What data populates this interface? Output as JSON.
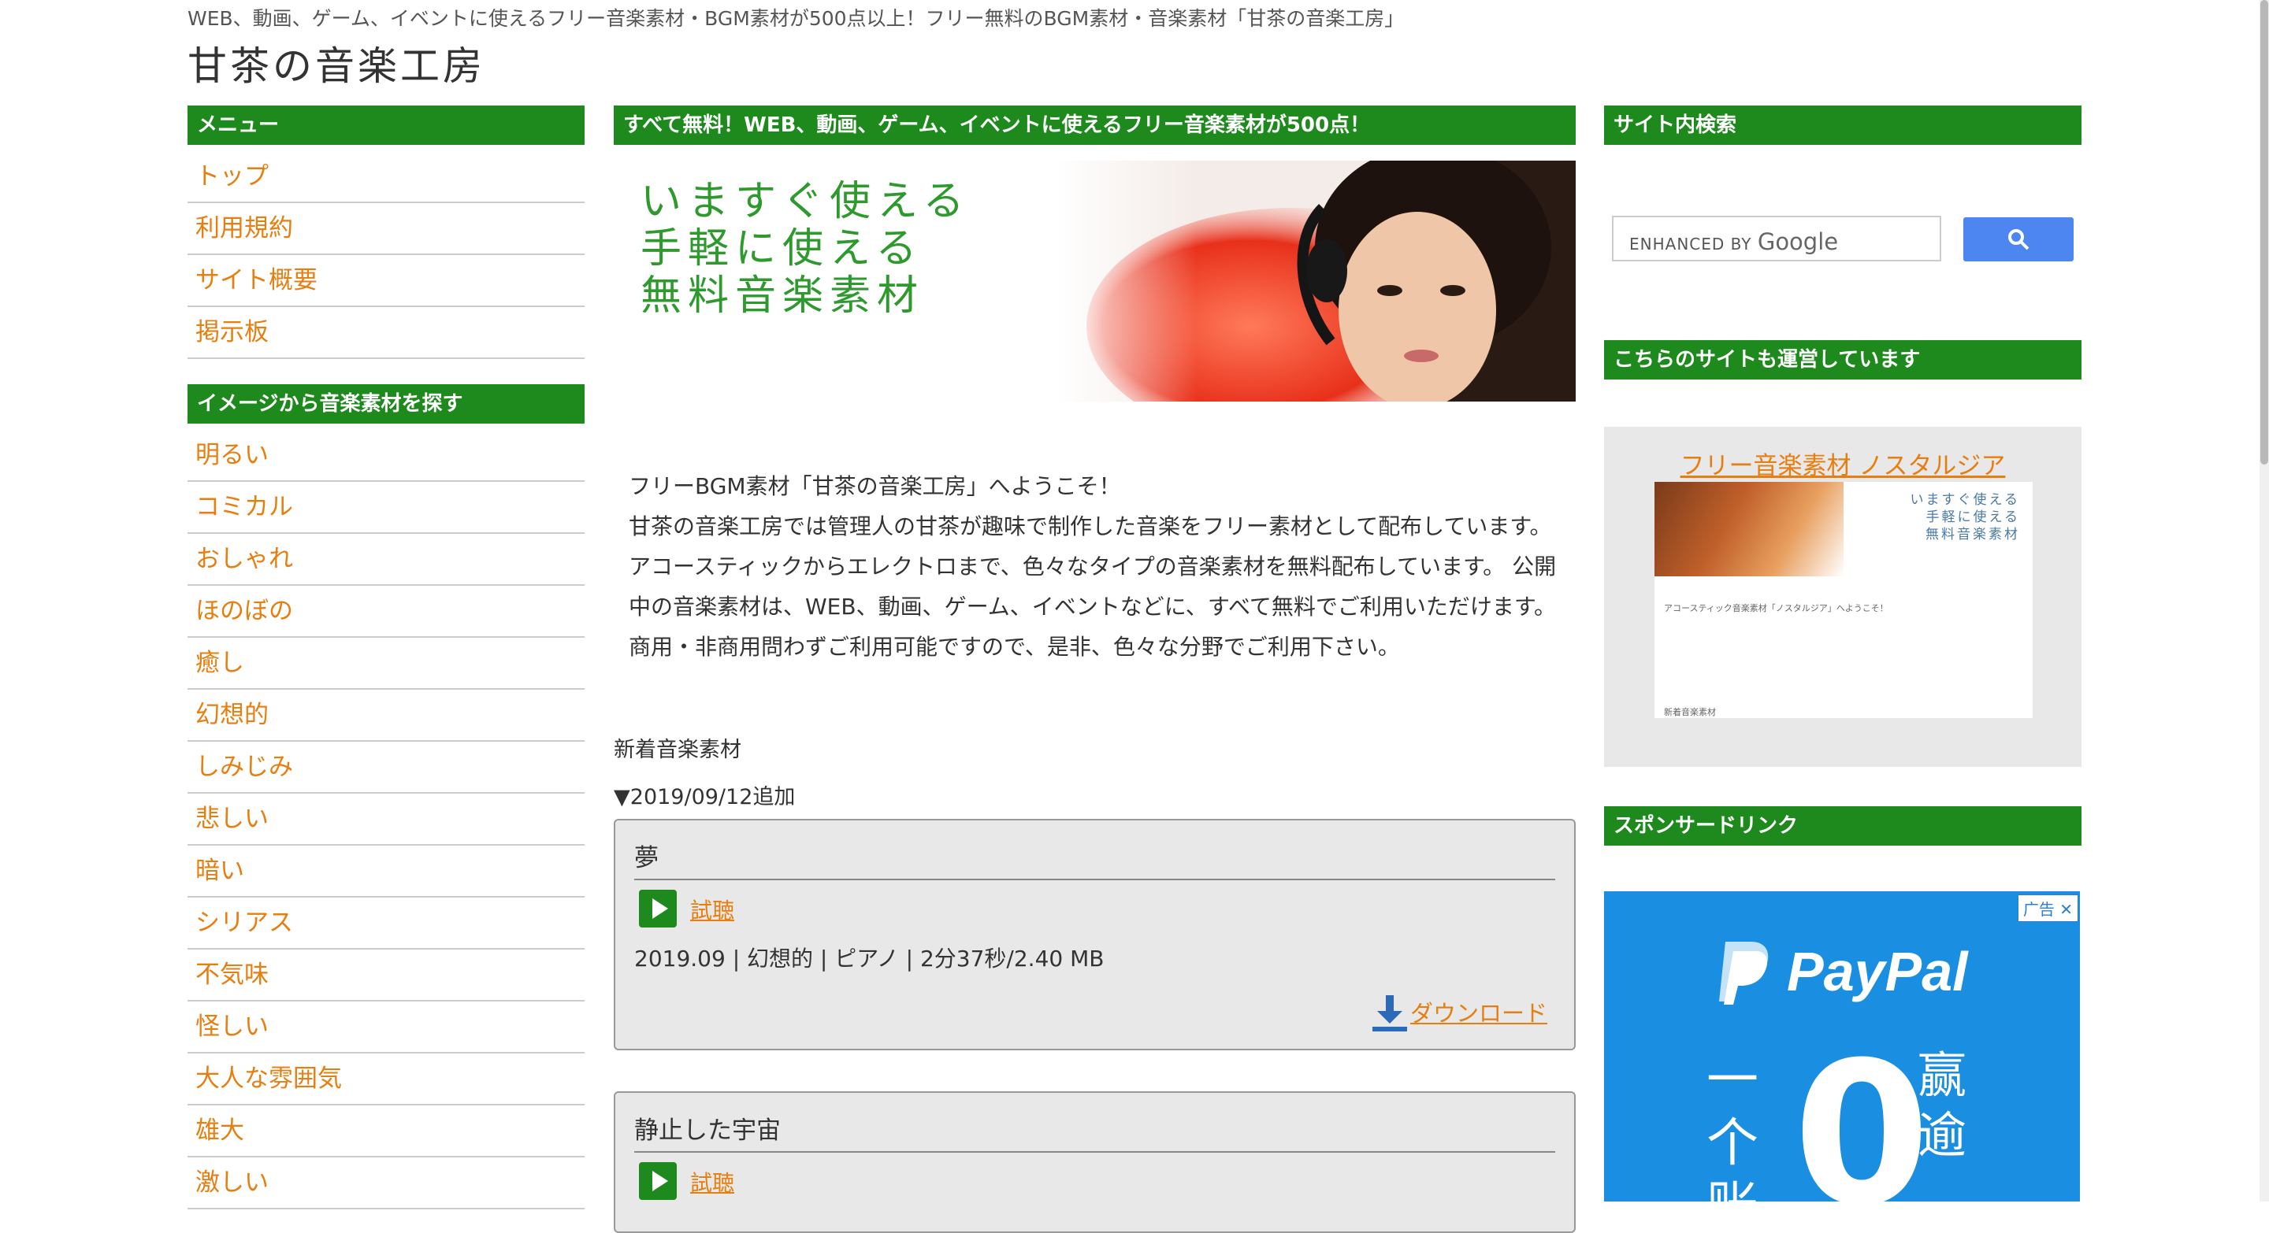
{
  "header": {
    "tagline": "WEB、動画、ゲーム、イベントに使えるフリー音楽素材・BGM素材が500点以上！フリー無料のBGM素材・音楽素材「甘茶の音楽工房」",
    "site_title": "甘茶の音楽工房"
  },
  "sidebar_left": {
    "menu_heading": "メニュー",
    "menu_items": [
      "トップ",
      "利用規約",
      "サイト概要",
      "掲示板"
    ],
    "image_heading": "イメージから音楽素材を探す",
    "image_items": [
      "明るい",
      "コミカル",
      "おしゃれ",
      "ほのぼの",
      "癒し",
      "幻想的",
      "しみじみ",
      "悲しい",
      "暗い",
      "シリアス",
      "不気味",
      "怪しい",
      "大人な雰囲気",
      "雄大",
      "激しい"
    ]
  },
  "main": {
    "banner_heading": "すべて無料！WEB、動画、ゲーム、イベントに使えるフリー音楽素材が500点！",
    "hero_lines": [
      "いますぐ使える",
      "手軽に使える",
      "無料音楽素材"
    ],
    "welcome_title": "フリーBGM素材「甘茶の音楽工房」へようこそ！",
    "welcome_body": "甘茶の音楽工房では管理人の甘茶が趣味で制作した音楽をフリー素材として配布しています。アコースティックからエレクトロまで、色々なタイプの音楽素材を無料配布しています。 公開中の音楽素材は、WEB、動画、ゲーム、イベントなどに、すべて無料でご利用いただけます。 商用・非商用問わずご利用可能ですので、是非、色々な分野でご利用下さい。",
    "new_heading": "新着音楽素材",
    "date_heading": "▼2019/09/12追加",
    "tracks": [
      {
        "title": "夢",
        "listen": "試聴",
        "meta": "2019.09 | 幻想的 | ピアノ | 2分37秒/2.40 MB",
        "download": "ダウンロード"
      },
      {
        "title": "静止した宇宙",
        "listen": "試聴"
      }
    ]
  },
  "sidebar_right": {
    "search_heading": "サイト内検索",
    "search_placeholder_prefix": "ENHANCED BY",
    "search_placeholder_brand": "Google",
    "sites_heading": "こちらのサイトも運営しています",
    "promo_link": "フリー音楽素材 ノスタルジア",
    "promo_thumb_lines": [
      "いますぐ使える",
      "手軽に使える",
      "無料音楽素材"
    ],
    "promo_thumb_title": "アコースティック音楽素材「ノスタルジア」へようこそ！",
    "promo_thumb_caption": "新着音楽素材",
    "sponsor_heading": "スポンサードリンク",
    "ad": {
      "badge": "广告",
      "brand": "PayPal",
      "big": "0",
      "left_text": "一个账",
      "right_text": "赢逾"
    }
  },
  "colors": {
    "accent_green": "#1e8a1e",
    "link_orange": "#e67e10",
    "google_blue": "#4d86f0",
    "paypal_blue": "#1a8ee0"
  }
}
